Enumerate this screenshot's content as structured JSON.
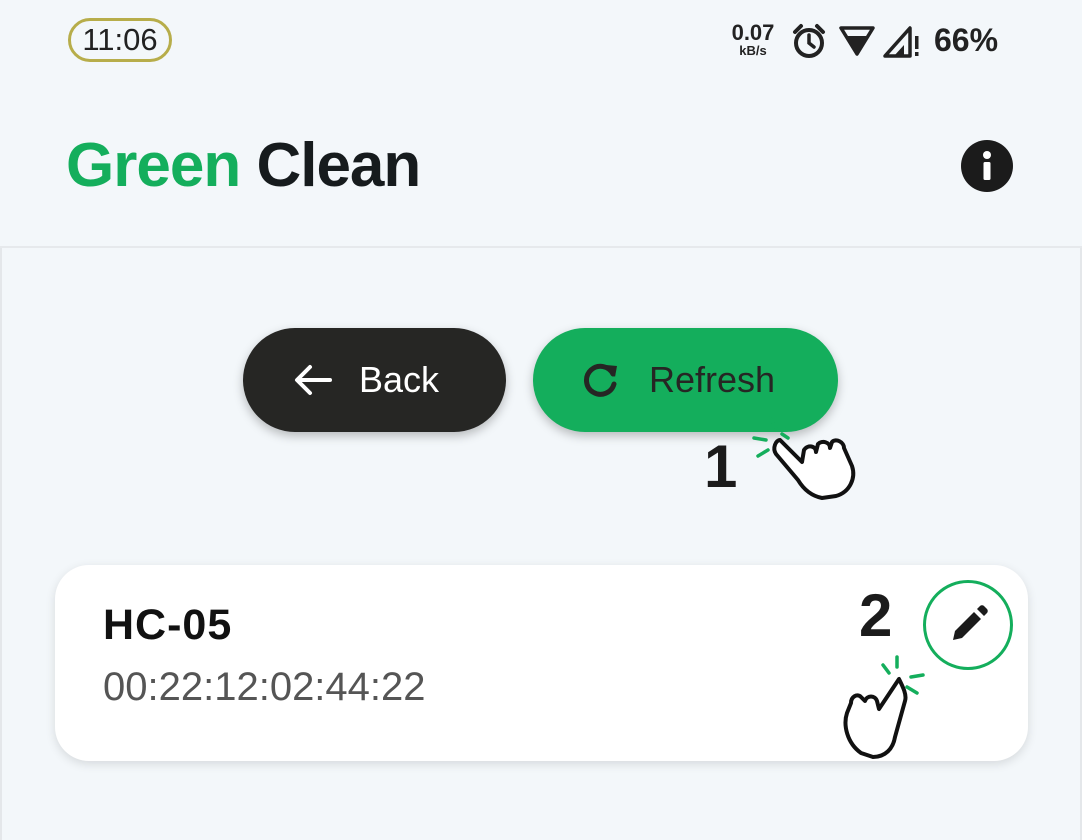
{
  "status_bar": {
    "time": "11:06",
    "net_speed_value": "0.07",
    "net_speed_unit": "kB/s",
    "battery": "66%",
    "icons": [
      "alarm-icon",
      "wifi-icon",
      "cell-signal-icon"
    ]
  },
  "app_bar": {
    "title_part1": "Green",
    "title_part2": "Clean",
    "info_icon": "info-icon"
  },
  "actions": {
    "back_label": "Back",
    "refresh_label": "Refresh"
  },
  "annotations": {
    "step1": "1",
    "step2": "2"
  },
  "device": {
    "name": "HC-05",
    "address": "00:22:12:02:44:22"
  },
  "colors": {
    "brand_green": "#14ae5c",
    "dark": "#262624",
    "background": "#f3f7fa",
    "time_border": "#b7ad4a"
  }
}
